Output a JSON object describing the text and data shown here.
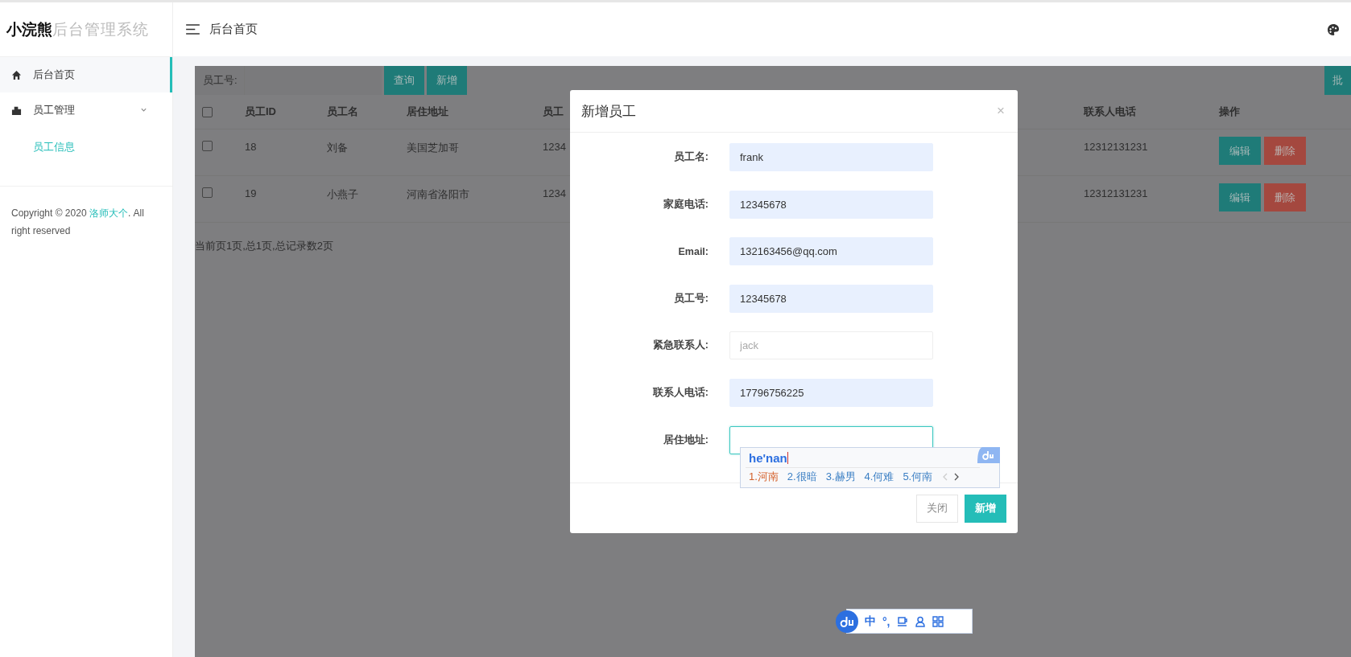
{
  "sidebar": {
    "logo": {
      "brand": "小浣熊",
      "subtitle": "后台管理系统"
    },
    "items": [
      {
        "label": "后台首页",
        "selected": true
      },
      {
        "label": "员工管理",
        "selected": false,
        "expanded": true,
        "children": [
          {
            "label": "员工信息",
            "selected": true
          }
        ]
      }
    ],
    "copyright": {
      "before": "Copyright © 2020 ",
      "link": "洛师大个",
      "after": ". All right reserved"
    }
  },
  "header": {
    "title": "后台首页"
  },
  "toolbar": {
    "label": "员工号:",
    "buttons": [
      "查询",
      "新增"
    ],
    "right_button": "批"
  },
  "table": {
    "select_all_checked": false,
    "columns": [
      "员工ID",
      "员工名",
      "居住地址",
      "员工",
      "联系人电话",
      "操作"
    ],
    "rows": [
      {
        "checked": false,
        "cells": [
          "18",
          "刘备",
          "美国芝加哥",
          "1234",
          "12312131231"
        ],
        "actions": [
          "编辑",
          "删除"
        ]
      },
      {
        "checked": false,
        "cells": [
          "19",
          "小燕子",
          "河南省洛阳市",
          "1234",
          "12312131231"
        ],
        "actions": [
          "编辑",
          "删除"
        ]
      }
    ]
  },
  "pagination": "当前页1页,总1页,总记录数2页",
  "dialog": {
    "title": "新增员工",
    "close": "×",
    "fields": [
      {
        "label": "员工名:",
        "value": "frank",
        "focused": false
      },
      {
        "label": "家庭电话:",
        "value": "12345678",
        "focused": false
      },
      {
        "label": "Email:",
        "value": "132163456@qq.com",
        "focused": false
      },
      {
        "label": "员工号:",
        "value": "12345678",
        "focused": false
      },
      {
        "label": "紧急联系人:",
        "placeholder": "jack",
        "focused": false
      },
      {
        "label": "联系人电话:",
        "value": "17796756225",
        "focused": false
      },
      {
        "label": "居住地址:",
        "focused": true
      }
    ],
    "buttons": [
      {
        "label": "关闭",
        "kind": "default"
      },
      {
        "label": "新增",
        "kind": "primary"
      }
    ]
  },
  "ime": {
    "composition": "he'nan",
    "candidates": [
      {
        "label": "1.河南",
        "selected": true
      },
      {
        "label": "2.很暗",
        "selected": false
      },
      {
        "label": "3.赫男",
        "selected": false
      },
      {
        "label": "4.何难",
        "selected": false
      },
      {
        "label": "5.何南",
        "selected": false
      }
    ],
    "status": [
      "中",
      "°,"
    ]
  }
}
